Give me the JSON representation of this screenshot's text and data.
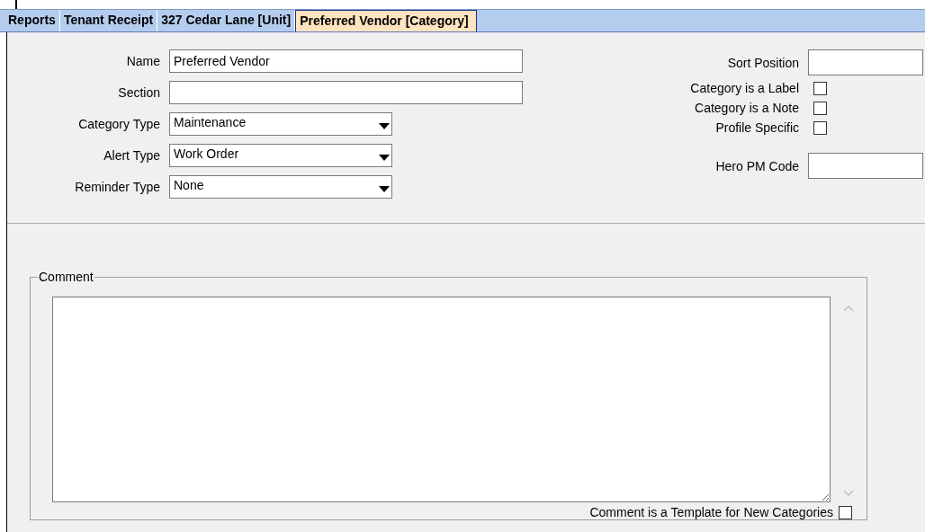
{
  "tabs": [
    {
      "label": "Reports",
      "selected": false
    },
    {
      "label": "Tenant Receipt",
      "selected": false
    },
    {
      "label": "327 Cedar Lane  [Unit]",
      "selected": false
    },
    {
      "label": "Preferred Vendor  [Category]",
      "selected": true
    }
  ],
  "fields": [
    {
      "kind": "text",
      "label": "Name",
      "value": "Preferred Vendor"
    },
    {
      "kind": "text",
      "label": "Section"
    },
    {
      "kind": "select",
      "label": "Category Type",
      "value": "Maintenance"
    },
    {
      "kind": "select",
      "label": "Alert Type",
      "value": "Work Order"
    },
    {
      "kind": "select",
      "label": "Reminder Type",
      "value": "None"
    }
  ],
  "options": [
    {
      "kind": "text",
      "label": "Sort Position"
    },
    {
      "kind": "checkbox",
      "label": "Category is a Label",
      "checked": false
    },
    {
      "kind": "checkbox",
      "label": "Category is a Note",
      "checked": false
    },
    {
      "kind": "checkbox",
      "label": "Profile Specific",
      "checked": false
    },
    {
      "kind": "spacer"
    },
    {
      "kind": "text",
      "label": "Hero PM Code"
    }
  ],
  "comment": {
    "label": "Comment"
  },
  "template_option": {
    "label": "Comment is a Template for New Categories",
    "checked": false
  }
}
